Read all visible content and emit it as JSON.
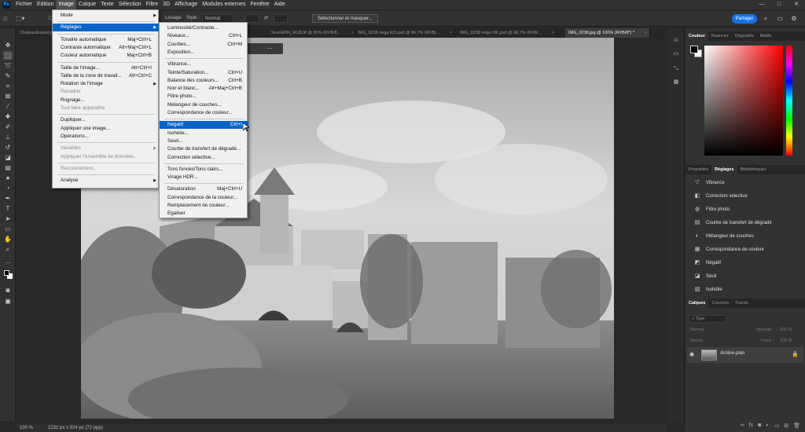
{
  "menubar": {
    "items": [
      "Fichier",
      "Edition",
      "Image",
      "Calque",
      "Texte",
      "Sélection",
      "Filtre",
      "3D",
      "Affichage",
      "Modules externes",
      "Fenêtre",
      "Aide"
    ],
    "active_index": 2,
    "logo": "Ps"
  },
  "window_controls": {
    "minimize": "—",
    "maximize": "□",
    "close": "✕"
  },
  "options_bar": {
    "style_label": "Style :",
    "style_value": "Normal",
    "lissage_label": "Lissage",
    "select_mask_label": "Sélectionner et masquer...",
    "share_label": "Partager"
  },
  "tabs": [
    {
      "label": "Chateaubryand.jpg...",
      "active": false
    },
    {
      "label": "ScanEDN_RGB.tif @ 50% (RVB/8...",
      "active": false
    },
    {
      "label": "IMG_0238 nega KO.psd @ 66,7% (RVB/...",
      "active": false
    },
    {
      "label": "IMG_0238 nega OK.psd @ 66,7% (RVB/...",
      "active": false
    },
    {
      "label": "IMG_0238.jpg @ 100% (RVB/8*) *",
      "active": true
    }
  ],
  "image_menu": {
    "items": [
      {
        "label": "Mode",
        "sub": true
      },
      {
        "sep": true
      },
      {
        "label": "Réglages",
        "sub": true,
        "highlight": true
      },
      {
        "sep": true
      },
      {
        "label": "Tonalité automatique",
        "shortcut": "Maj+Ctrl+L"
      },
      {
        "label": "Contraste automatique",
        "shortcut": "Alt+Maj+Ctrl+L"
      },
      {
        "label": "Couleur automatique",
        "shortcut": "Maj+Ctrl+B"
      },
      {
        "sep": true
      },
      {
        "label": "Taille de l'image...",
        "shortcut": "Alt+Ctrl+I"
      },
      {
        "label": "Taille de la zone de travail...",
        "shortcut": "Alt+Ctrl+C"
      },
      {
        "label": "Rotation de l'image",
        "sub": true
      },
      {
        "label": "Recadrer",
        "disabled": true
      },
      {
        "label": "Rognage..."
      },
      {
        "label": "Tout faire apparaître",
        "disabled": true
      },
      {
        "sep": true
      },
      {
        "label": "Dupliquer..."
      },
      {
        "label": "Appliquer une image..."
      },
      {
        "label": "Opérations..."
      },
      {
        "sep": true
      },
      {
        "label": "Variables",
        "sub": true,
        "disabled": true
      },
      {
        "label": "Appliquer l'ensemble de données...",
        "disabled": true
      },
      {
        "sep": true
      },
      {
        "label": "Recouvrement...",
        "disabled": true
      },
      {
        "sep": true
      },
      {
        "label": "Analyse",
        "sub": true
      }
    ]
  },
  "reglages_menu": {
    "items": [
      {
        "label": "Luminosité/Contraste..."
      },
      {
        "label": "Niveaux...",
        "shortcut": "Ctrl+L"
      },
      {
        "label": "Courbes...",
        "shortcut": "Ctrl+M"
      },
      {
        "label": "Exposition..."
      },
      {
        "sep": true
      },
      {
        "label": "Vibrance..."
      },
      {
        "label": "Teinte/Saturation...",
        "shortcut": "Ctrl+U"
      },
      {
        "label": "Balance des couleurs...",
        "shortcut": "Ctrl+B"
      },
      {
        "label": "Noir et blanc...",
        "shortcut": "Alt+Maj+Ctrl+B"
      },
      {
        "label": "Filtre photo..."
      },
      {
        "label": "Mélangeur de couches..."
      },
      {
        "label": "Correspondance de couleur..."
      },
      {
        "sep": true
      },
      {
        "label": "Négatif",
        "shortcut": "Ctrl+I",
        "highlight": true
      },
      {
        "label": "Isohélie..."
      },
      {
        "label": "Seuil..."
      },
      {
        "label": "Courbe de transfert de dégradé..."
      },
      {
        "label": "Correction sélective..."
      },
      {
        "sep": true
      },
      {
        "label": "Tons foncés/Tons clairs..."
      },
      {
        "label": "Virage HDR..."
      },
      {
        "sep": true
      },
      {
        "label": "Désaturation",
        "shortcut": "Maj+Ctrl+U"
      },
      {
        "label": "Correspondance de la couleur..."
      },
      {
        "label": "Remplacement de couleur..."
      },
      {
        "label": "Egaliser"
      }
    ]
  },
  "color_panel": {
    "tabs": [
      "Couleur",
      "Nuancier",
      "Dégradés",
      "Motifs"
    ],
    "active_tab": 0,
    "foreground": "#000000",
    "background": "#ffffff"
  },
  "adjust_panel": {
    "tabs": [
      "Propriétés",
      "Réglages",
      "Bibliothèques"
    ],
    "active_tab": 1,
    "items": [
      {
        "label": "Vibrance",
        "icon": "triangle-icon"
      },
      {
        "label": "Correction sélective",
        "icon": "selective-color-icon"
      },
      {
        "label": "Filtre photo",
        "icon": "photo-filter-icon"
      },
      {
        "label": "Courbe de transfert de dégradé",
        "icon": "gradient-map-icon"
      },
      {
        "label": "Mélangeur de couches",
        "icon": "channel-mixer-icon"
      },
      {
        "label": "Correspondance de couleur",
        "icon": "color-lookup-icon"
      },
      {
        "label": "Négatif",
        "icon": "invert-icon"
      },
      {
        "label": "Seuil",
        "icon": "threshold-icon"
      },
      {
        "label": "Isohélie",
        "icon": "posterize-icon"
      }
    ]
  },
  "layers_panel": {
    "tabs": [
      "Calques",
      "Couches",
      "Tracés"
    ],
    "active_tab": 0,
    "filter_placeholder": "Type",
    "blend_mode": "Normal",
    "opacity_label": "Opacité :",
    "opacity_value": "100 %",
    "lock_label": "Verrou :",
    "fill_label": "Fond :",
    "fill_value": "100 %",
    "layer_name": "Arrière-plan"
  },
  "status": {
    "zoom": "100 %",
    "dimensions": "1232 px x 924 px (72 ppp)"
  }
}
